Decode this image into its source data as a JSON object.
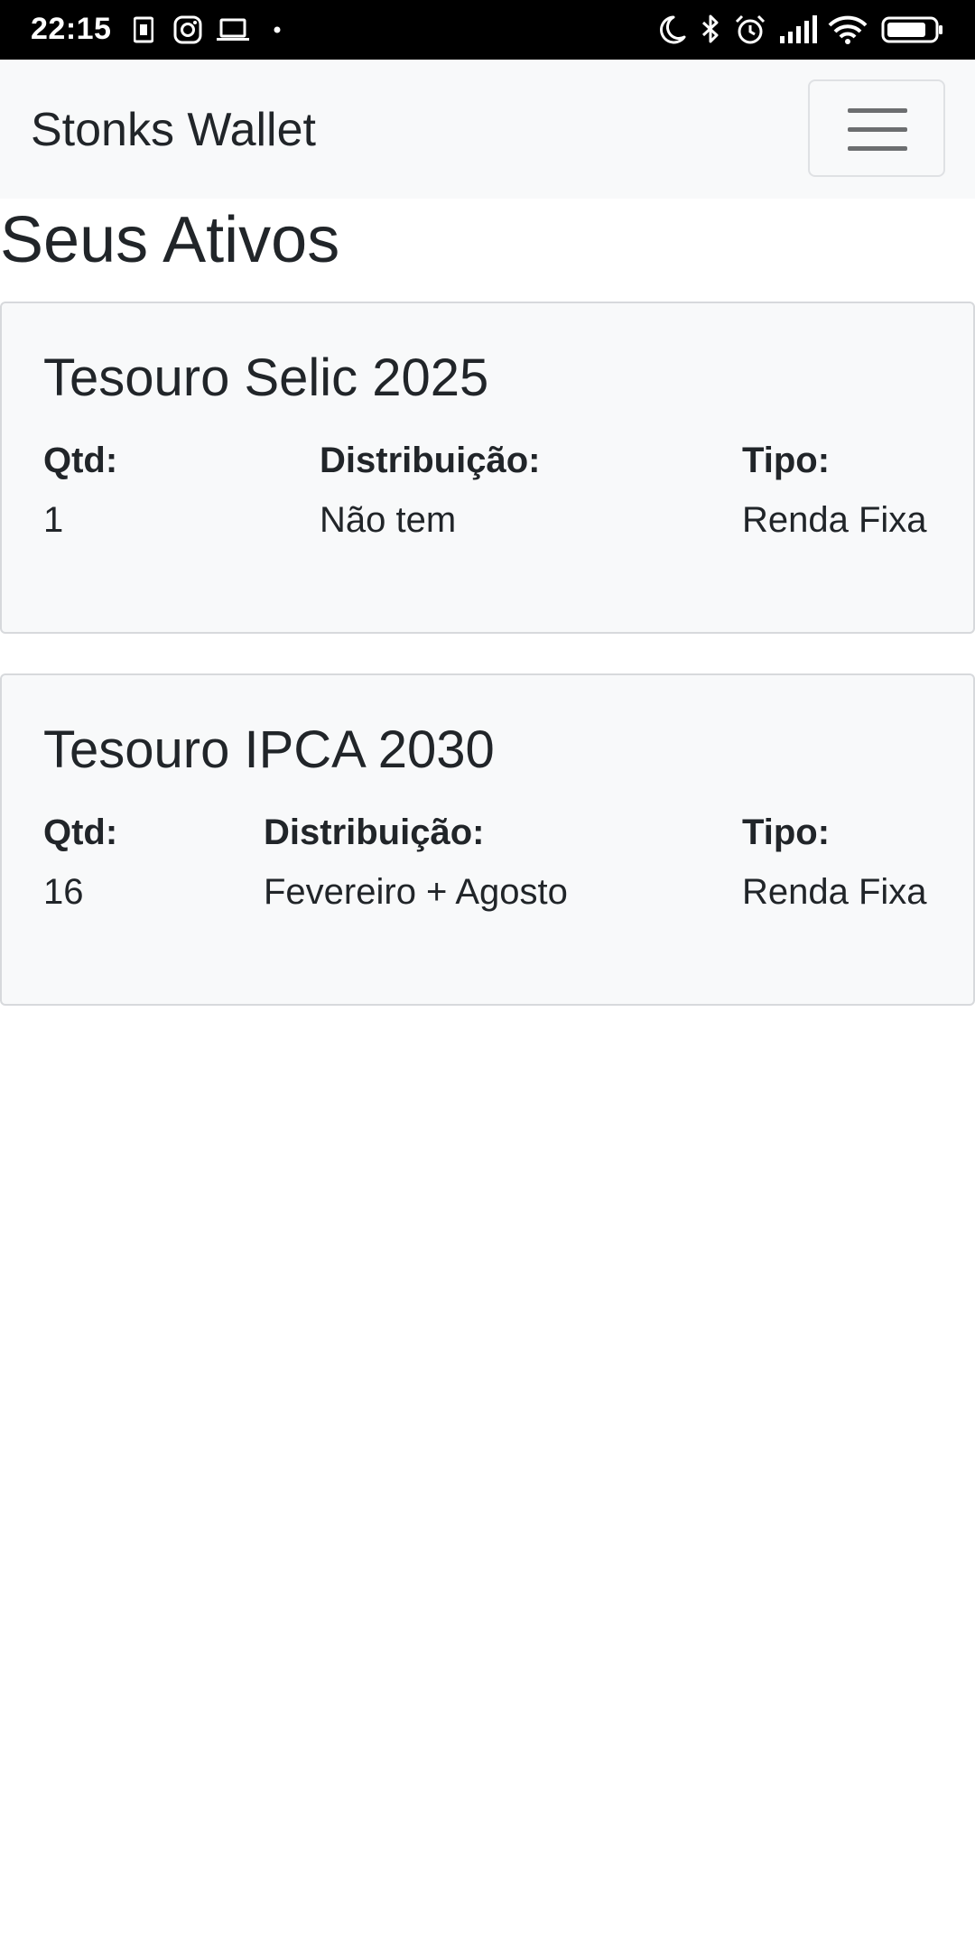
{
  "status_bar": {
    "time": "22:15",
    "left_icons": [
      "sim-card-icon",
      "instagram-icon",
      "laptop-icon",
      "dot-icon"
    ],
    "right_icons": [
      "moon-icon",
      "bluetooth-icon",
      "alarm-icon",
      "signal-icon",
      "wifi-icon",
      "battery-icon"
    ]
  },
  "navbar": {
    "brand": "Stonks Wallet",
    "menu_icon": "hamburger-menu-icon"
  },
  "page": {
    "title": "Seus Ativos"
  },
  "assets": [
    {
      "name": "Tesouro Selic 2025",
      "qty_label": "Qtd:",
      "qty": "1",
      "distribution_label": "Distribuição:",
      "distribution": "Não tem",
      "type_label": "Tipo:",
      "type": "Renda Fixa"
    },
    {
      "name": "Tesouro IPCA 2030",
      "qty_label": "Qtd:",
      "qty": "16",
      "distribution_label": "Distribuição:",
      "distribution": "Fevereiro + Agosto",
      "type_label": "Tipo:",
      "type": "Renda Fixa"
    }
  ],
  "colors": {
    "status_bar": "#000000",
    "navbar_bg": "#f8f9fa",
    "card_bg": "#f8f9fa",
    "text": "#212529",
    "card_border": "#d7d9dc"
  }
}
